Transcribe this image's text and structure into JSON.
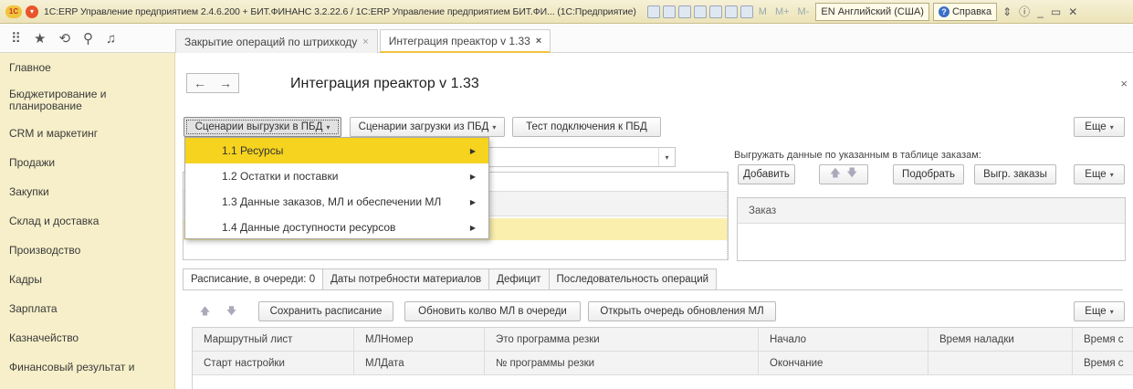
{
  "titlebar": {
    "logo": "1С",
    "title": "1С:ERP Управление предприятием 2.4.6.200 + БИТ.ФИНАНС 3.2.22.6 / 1С:ERP Управление предприятием БИТ.ФИ... (1С:Предприятие)",
    "m1": "M",
    "m2": "M+",
    "m3": "M-",
    "language": "EN Английский (США)",
    "help": "Справка"
  },
  "tabs": [
    {
      "label": "Закрытие операций по штрихкоду"
    },
    {
      "label": "Интеграция преактор v 1.33"
    }
  ],
  "sidebar": {
    "items": [
      {
        "label": "Главное"
      },
      {
        "label": "Бюджетирование и планирование"
      },
      {
        "label": "CRM и маркетинг"
      },
      {
        "label": "Продажи"
      },
      {
        "label": "Закупки"
      },
      {
        "label": "Склад и доставка"
      },
      {
        "label": "Производство"
      },
      {
        "label": "Кадры"
      },
      {
        "label": "Зарплата"
      },
      {
        "label": "Казначейство"
      },
      {
        "label": "Финансовый результат и"
      }
    ]
  },
  "main": {
    "title": "Интеграция преактор v 1.33",
    "toolbar": {
      "scenarios_export": "Сценарии выгрузки в ПБД",
      "scenarios_import": "Сценарии загрузки из ПБД",
      "test_connection": "Тест подключения к ПБД",
      "more": "Еще"
    },
    "dropdown": [
      {
        "label": "1.1 Ресурсы"
      },
      {
        "label": "1.2 Остатки и поставки"
      },
      {
        "label": "1.3 Данные заказов, МЛ и обеспечении МЛ"
      },
      {
        "label": "1.4 Данные доступности ресурсов"
      }
    ],
    "orders": {
      "label": "Выгружать данные по указанным в таблице заказам:",
      "add": "Добавить",
      "pick": "Подобрать",
      "export_orders": "Выгр. заказы",
      "more": "Еще",
      "column": "Заказ"
    },
    "bottom_tabs": [
      {
        "label": "Расписание, в очереди: 0"
      },
      {
        "label": "Даты потребности материалов"
      },
      {
        "label": "Дефицит"
      },
      {
        "label": "Последовательность операций"
      }
    ],
    "schedule_toolbar": {
      "save": "Сохранить расписание",
      "update_qty": "Обновить колво МЛ в очереди",
      "open_queue": "Открыть очередь обновления МЛ",
      "more": "Еще"
    },
    "table": {
      "row1": [
        "Маршрутный лист",
        "МЛНомер",
        "Это программа резки",
        "Начало",
        "Время наладки",
        "Время с"
      ],
      "row2": [
        "Старт настройки",
        "МЛДата",
        "№ программы резки",
        "Окончание",
        "",
        "Время с"
      ]
    }
  }
}
